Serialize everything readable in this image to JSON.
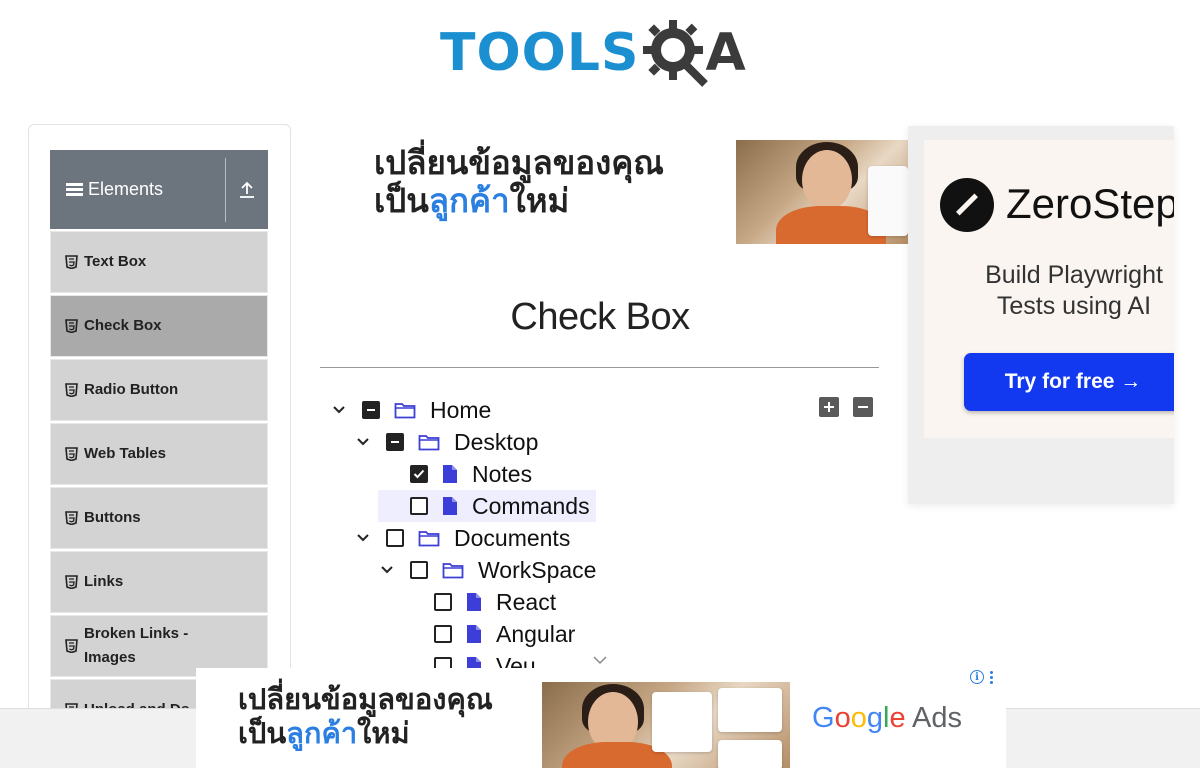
{
  "header": {
    "logo_text_left": "TOOLS",
    "logo_text_right": "A"
  },
  "sidebar": {
    "group_title": "Elements",
    "items": [
      {
        "label": "Text Box",
        "active": false
      },
      {
        "label": "Check Box",
        "active": true
      },
      {
        "label": "Radio Button",
        "active": false
      },
      {
        "label": "Web Tables",
        "active": false
      },
      {
        "label": "Buttons",
        "active": false
      },
      {
        "label": "Links",
        "active": false
      },
      {
        "label": "Broken Links - Images",
        "active": false
      },
      {
        "label": "Upload and Do",
        "active": false
      }
    ]
  },
  "main": {
    "title": "Check Box",
    "tree": [
      {
        "label": "Home",
        "level": 0,
        "type": "folder",
        "state": "half",
        "expanded": true
      },
      {
        "label": "Desktop",
        "level": 1,
        "type": "folder",
        "state": "half",
        "expanded": true
      },
      {
        "label": "Notes",
        "level": 2,
        "type": "file",
        "state": "checked"
      },
      {
        "label": "Commands",
        "level": 2,
        "type": "file",
        "state": "unchecked",
        "highlighted": true
      },
      {
        "label": "Documents",
        "level": 1,
        "type": "folder",
        "state": "unchecked",
        "expanded": true
      },
      {
        "label": "WorkSpace",
        "level": 2,
        "type": "folder",
        "state": "unchecked",
        "expanded": true
      },
      {
        "label": "React",
        "level": 3,
        "type": "file",
        "state": "unchecked"
      },
      {
        "label": "Angular",
        "level": 3,
        "type": "file",
        "state": "unchecked"
      },
      {
        "label": "Veu",
        "level": 3,
        "type": "file",
        "state": "unchecked"
      }
    ],
    "expand_all_icon": "plus-square-icon",
    "collapse_all_icon": "minus-square-icon"
  },
  "ads": {
    "thai_line1": "เปลี่ยนข้อมูลของคุณ",
    "thai_line2_a": "เป็น",
    "thai_line2_b": "ลูกค้า",
    "thai_line2_c": "ใหม่",
    "zerostep_name": "ZeroStep",
    "zerostep_tagline": "Build Playwright Tests using AI",
    "zerostep_cta": "Try for free →",
    "google_ads": {
      "g": "G",
      "o1": "o",
      "o2": "o",
      "g2": "g",
      "l": "l",
      "e": "e",
      "ads": "Ads"
    }
  },
  "colors": {
    "brand_blue": "#1b8fd0",
    "sidebar_header": "#6c757d",
    "menu_bg": "#d3d3d3",
    "menu_active": "#aaaaaa",
    "tree_icon": "#3d3dd8",
    "cta_blue": "#1238f0"
  }
}
